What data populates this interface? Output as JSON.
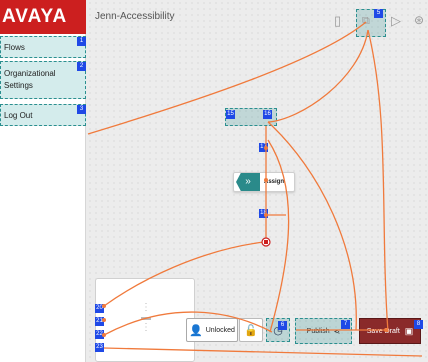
{
  "brand": {
    "logo_text": "AVAYA"
  },
  "header": {
    "title": "Jenn-Accessibility"
  },
  "sidebar": {
    "items": [
      {
        "label": "Flows",
        "tag": "1"
      },
      {
        "label": "Organizational Settings",
        "tag": "2"
      },
      {
        "label": "Log Out",
        "tag": "3"
      }
    ]
  },
  "toolbar": {
    "copy_tag": "5"
  },
  "flow": {
    "assign_label": "Assign",
    "node_tags": {
      "top_left": "15",
      "top_right": "16",
      "upper": "17",
      "lower": "18"
    }
  },
  "bottom_bar": {
    "unlocked_label": "Unlocked",
    "publish_label": "Publish",
    "save_draft_label": "Save Draft",
    "tags": {
      "history": "6",
      "publish": "7",
      "save": "8"
    }
  },
  "mini_panel": {
    "tags": [
      "20",
      "21",
      "22",
      "23"
    ]
  },
  "colors": {
    "brand_red": "#cc1f1f",
    "teal": "#2b8f8f",
    "tag_blue": "#1f49e6",
    "connector_orange": "#f07a3c",
    "save_button": "#8a2a2a"
  }
}
